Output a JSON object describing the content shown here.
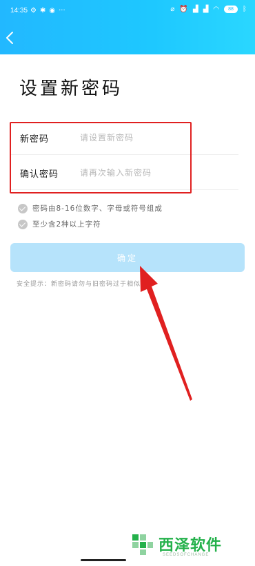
{
  "status_bar": {
    "time": "14:35",
    "left_icons": [
      "app-icon-1",
      "app-icon-2",
      "app-icon-3",
      "more-dots-icon"
    ],
    "right_icons": [
      "nfc-icon",
      "alarm-icon",
      "hd-signal-icon",
      "hd-signal-icon",
      "wifi-icon",
      "bluetooth-icon"
    ],
    "battery": "88"
  },
  "header": {
    "back_icon": "chevron-left-icon",
    "color_start": "#22b8ff",
    "color_end": "#2ad7ff"
  },
  "page": {
    "title": "设置新密码"
  },
  "form": {
    "new_password": {
      "label": "新密码",
      "placeholder": "请设置新密码"
    },
    "confirm_password": {
      "label": "确认密码",
      "placeholder": "请再次输入新密码"
    }
  },
  "rules": [
    "密码由8-16位数字、字母或符号组成",
    "至少含2种以上字符"
  ],
  "confirm_button": {
    "label": "确定",
    "color": "#b6e3fb"
  },
  "tip": {
    "text": "安全提示：新密码请勿与旧密码过于相似。"
  },
  "annotations": {
    "highlight_color": "#e02020",
    "arrow_color": "#e02020"
  },
  "watermark": {
    "text": "西泽软件",
    "subtext": "SEEDSOFCHANGE",
    "color": "#24b14b"
  }
}
